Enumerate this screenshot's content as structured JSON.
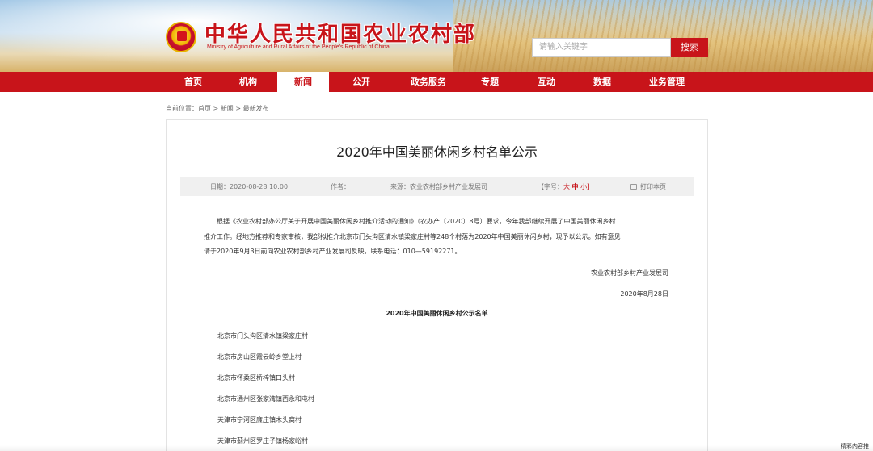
{
  "header": {
    "site_title": "中华人民共和国农业农村部",
    "site_subtitle": "Ministry of Agriculture and Rural Affairs of the People's Republic of China",
    "emblem_icon": "national-emblem-icon",
    "search": {
      "placeholder": "请输入关键字",
      "button_label": "搜索"
    },
    "accent_color": "#c8141a"
  },
  "nav": {
    "items": [
      {
        "label": "首页"
      },
      {
        "label": "机构"
      },
      {
        "label": "新闻",
        "active": true
      },
      {
        "label": "公开"
      },
      {
        "label": "政务服务"
      },
      {
        "label": "专题"
      },
      {
        "label": "互动"
      },
      {
        "label": "数据"
      },
      {
        "label": "业务管理"
      }
    ]
  },
  "breadcrumb": "当前位置：首页 > 新闻 > 最新发布",
  "article": {
    "title": "2020年中国美丽休闲乡村名单公示",
    "meta": {
      "date": "日期：2020-08-28 10:00",
      "author": "作者：",
      "source": "来源：农业农村部乡村产业发展司",
      "font_size_label": "【字号：",
      "font_large": "大",
      "font_medium": "中",
      "font_small": "小】",
      "print_label": "打印本页",
      "print_icon": "printer-icon"
    },
    "body_line1": "根据《农业农村部办公厅关于开展中国美丽休闲乡村推介活动的通知》（农办产〔2020〕8号）要求，今年我部继续开展了中国美丽休闲乡村",
    "body_line2": "推介工作。经地方推荐和专家审核，我部拟推介北京市门头沟区清水镇梁家庄村等248个村落为2020年中国美丽休闲乡村，现予以公示。如有意见",
    "body_line3": "请于2020年9月3日前向农业农村部乡村产业发展司反映，联系电话：010—59192271。",
    "signature": "农业农村部乡村产业发展司",
    "sign_date": "2020年8月28日",
    "list_title": "2020年中国美丽休闲乡村公示名单",
    "list": [
      "北京市门头沟区清水镇梁家庄村",
      "北京市房山区霞云岭乡堂上村",
      "北京市怀柔区桥梓镇口头村",
      "北京市通州区张家湾镇西永和屯村",
      "天津市宁河区廉庄镇木头窝村",
      "天津市蓟州区罗庄子镇杨家峪村"
    ]
  },
  "corner_tag": "精彩内容推"
}
